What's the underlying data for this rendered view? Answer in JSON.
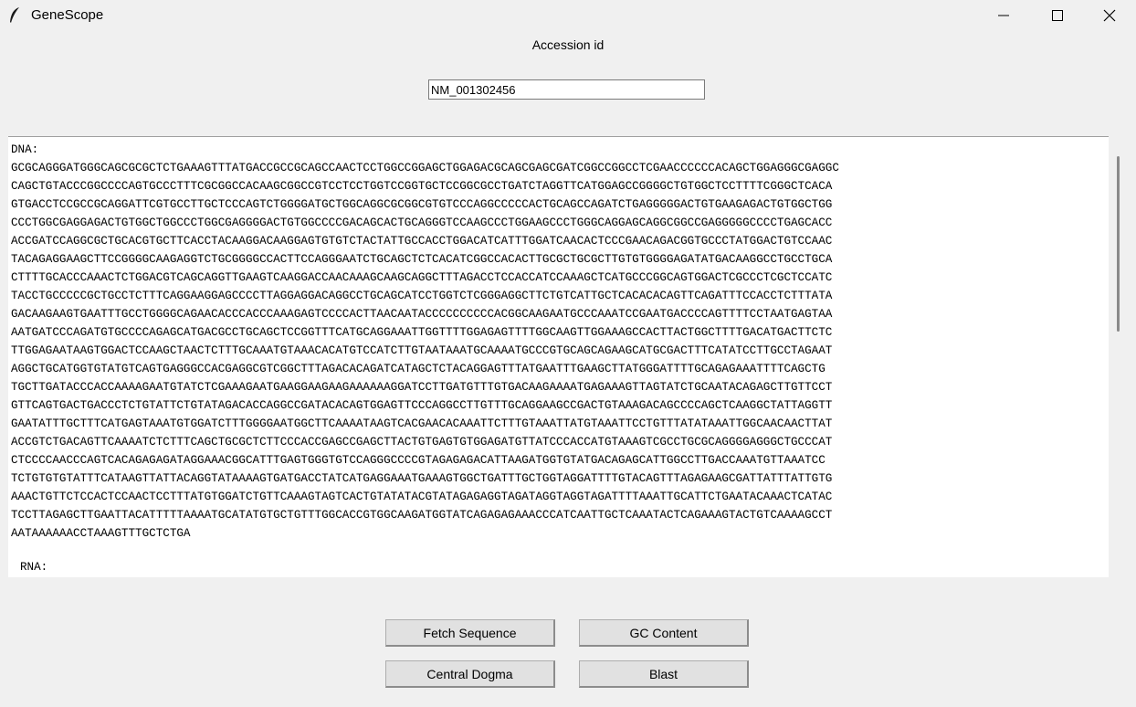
{
  "window": {
    "title": "GeneScope",
    "icon": "feather-icon"
  },
  "form": {
    "accession_label": "Accession id",
    "accession_value": "NM_001302456"
  },
  "output": {
    "dna_lines": [
      "DNA:",
      "GCGCAGGGATGGGCAGCGCGCTCTGAAAGTTTATGACCGCCGCAGCCAACTCCTGGCCGGAGCTGGAGACGCAGCGAGCGATCGGCCGGCCTCGAACCCCCCACAGCTGGAGGGCGAGGC",
      "CAGCTGTACCCGGCCCCAGTGCCCTTTCGCGGCCACAAGCGGCCGTCCTCCTGGTCCGGTGCTCCGGCGCCTGATCTAGGTTCATGGAGCCGGGGCTGTGGCTCCTTTTCGGGCTCACA",
      "GTGACCTCCGCCGCAGGATTCGTGCCTTGCTCCCAGTCTGGGGATGCTGGCAGGCGCGGCGTGTCCCAGGCCCCCACTGCAGCCAGATCTGAGGGGGACTGTGAAGAGACTGTGGCTGG",
      "CCCTGGCGAGGAGACTGTGGCTGGCCCTGGCGAGGGGACTGTGGCCCCGACAGCACTGCAGGGTCCAAGCCCTGGAAGCCCTGGGCAGGAGCAGGCGGCCGAGGGGGCCCCTGAGCACC",
      "ACCGATCCAGGCGCTGCACGTGCTTCACCTACAAGGACAAGGAGTGTGTCTACTATTGCCACCTGGACATCATTTGGATCAACACTCCCGAACAGACGGTGCCCTATGGACTGTCCAAC",
      "TACAGAGGAAGCTTCCGGGGCAAGAGGTCTGCGGGGCCACTTCCAGGGAATCTGCAGCTCTCACATCGGCCACACTTGCGCTGCGCTTGTGTGGGGAGATATGACAAGGCCTGCCTGCA",
      "CTTTTGCACCCAAACTCTGGACGTCAGCAGGTTGAAGTCAAGGACCAACAAAGCAAGCAGGCTTTAGACCTCCACCATCCAAAGCTCATGCCCGGCAGTGGACTCGCCCTCGCTCCATC",
      "TACCTGCCCCCGCTGCCTCTTTCAGGAAGGAGCCCCTTAGGAGGACAGGCCTGCAGCATCCTGGTCTCGGGAGGCTTCTGTCATTGCTCACACACAGTTCAGATTTCCACCTCTTTATA",
      "GACAAGAAGTGAATTTGCCTGGGGCAGAACACCCACCCAAAGAGTCCCCACTTAACAATACCCCCCCCCCACGGCAAGAATGCCCAAATCCGAATGACCCCAGTTTTCCTAATGAGTAA",
      "AATGATCCCAGATGTGCCCCAGAGCATGACGCCTGCAGCTCCGGTTTCATGCAGGAAATTGGTTTTGGAGAGTTTTGGCAAGTTGGAAAGCCACTTACTGGCTTTTGACATGACTTCTC",
      "TTGGAGAATAAGTGGACTCCAAGCTAACTCTTTGCAAATGTAAACACATGTCCATCTTGTAATAAATGCAAAATGCCCGTGCAGCAGAAGCATGCGACTTTCATATCCTTGCCTAGAAT",
      "AGGCTGCATGGTGTATGTCAGTGAGGGCCACGAGGCGTCGGCTTTAGACACAGATCATAGCTCTACAGGAGTTTATGAATTTGAAGCTTATGGGATTTTGCAGAGAAATTTTCAGCTG",
      "TGCTTGATACCCACCAAAAGAATGTATCTCGAAAGAATGAAGGAAGAAGAAAAAAGGATCCTTGATGTTTGTGACAAGAAAATGAGAAAGTTAGTATCTGCAATACAGAGCTTGTTCCT",
      "GTTCAGTGACTGACCCTCTGTATTCTGTATAGACACCAGGCCGATACACAGTGGAGTTCCCAGGCCTTGTTTGCAGGAAGCCGACTGTAAAGACAGCCCCAGCTCAAGGCTATTAGGTT",
      "GAATATTTGCTTTCATGAGTAAATGTGGATCTTTGGGGAATGGCTTCAAAATAAGTCACGAACACAAATTCTTTGTAAATTATGTAAATTCCTGTTTATATAAATTGGCAACAACTTAT",
      "ACCGTCTGACAGTTCAAAATCTCTTTCAGCTGCGCTCTTCCCACCGAGCCGAGCTTACTGTGAGTGTGGAGATGTTATCCCACCATGTAAAGTCGCCTGCGCAGGGGAGGGCTGCCCAT",
      "CTCCCCAACCCAGTCACAGAGAGATAGGAAACGGCATTTGAGTGGGTGTCCAGGGCCCCGTAGAGAGACATTAAGATGGTGTATGACAGAGCATTGGCCTTGACCAAATGTTAAATCC",
      "TCTGTGTGTATTTCATAAGTTATTACAGGTATAAAAGTGATGACCTATCATGAGGAAATGAAAGTGGCTGATTTGCTGGTAGGATTTTGTACAGTTTAGAGAAGCGATTATTTATTGTG",
      "AAACTGTTCTCCACTCCAACTCCTTTATGTGGATCTGTTCAAAGTAGTCACTGTATATACGTATAGAGAGGTAGATAGGTAGGTAGATTTTAAATTGCATTCTGAATACAAACTCATAC",
      "TCCTTAGAGCTTGAATTACATTTTTAAAATGCATATGTGCTGTTTGGCACCGTGGCAAGATGGTATCAGAGAGAAACCCATCAATTGCTCAAATACTCAGAAAGTACTGTCAAAAGCCT",
      "AATAAAAAACCTAAAGTTTGCTCTGA"
    ],
    "rna_label": "RNA:"
  },
  "buttons": {
    "fetch": "Fetch Sequence",
    "gc": "GC Content",
    "dogma": "Central Dogma",
    "blast": "Blast"
  }
}
